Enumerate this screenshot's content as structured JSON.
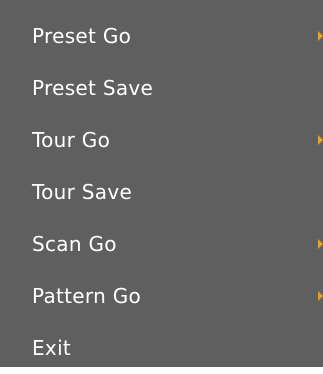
{
  "menu": {
    "items": [
      {
        "label": "Preset Go",
        "has_submenu": true
      },
      {
        "label": "Preset Save",
        "has_submenu": false
      },
      {
        "label": "Tour Go",
        "has_submenu": true
      },
      {
        "label": "Tour Save",
        "has_submenu": false
      },
      {
        "label": "Scan Go",
        "has_submenu": true
      },
      {
        "label": "Pattern Go",
        "has_submenu": true
      },
      {
        "label": "Exit",
        "has_submenu": false
      }
    ],
    "colors": {
      "background": "#5f5f5f",
      "text": "#ffffff",
      "arrow": "#f0a020"
    },
    "icons": {
      "submenu": "chevron-right-icon"
    }
  }
}
